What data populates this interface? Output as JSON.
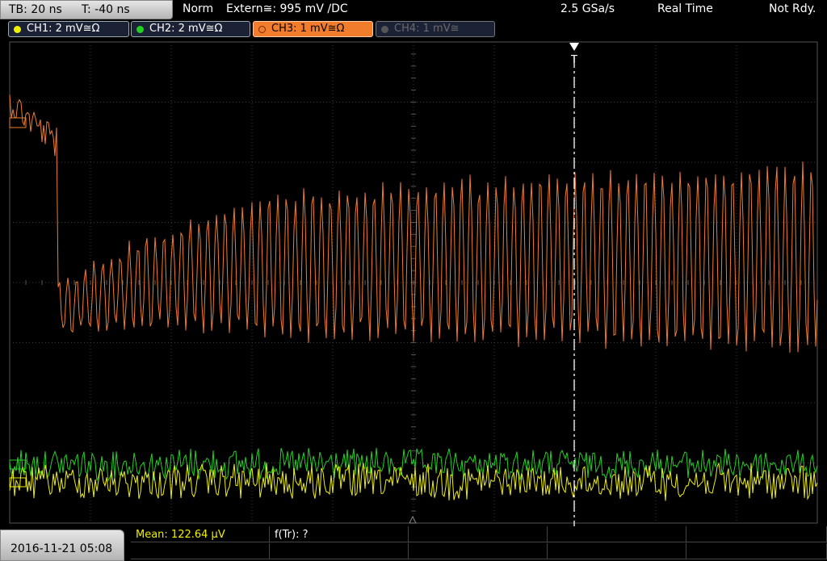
{
  "topbar": {
    "timebase": "TB: 20 ns",
    "trigger_offset": "T: -40 ns",
    "mode": "Norm",
    "trigger_source": "Extern≅: 995 mV ∕DC",
    "sample_rate": "2.5 GSa/s",
    "acq_mode": "Real Time",
    "status": "Not Rdy."
  },
  "channels": [
    {
      "label": "CH1: 2 mV≅Ω",
      "color": "#f0f000",
      "state": "on"
    },
    {
      "label": "CH2: 2 mV≅Ω",
      "color": "#22d022",
      "state": "on"
    },
    {
      "label": "CH3: 1 mV≅Ω",
      "color": "#f07c2c",
      "state": "active"
    },
    {
      "label": "CH4: 1 mV≅",
      "color": "#555555",
      "state": "off"
    }
  ],
  "measurements": {
    "mean": "Mean: 122.64 µV",
    "freq": "f(Tr): ?"
  },
  "datetime": "2016-11-21 05:08",
  "trigger_marker": "T",
  "colors": {
    "ch1": "#f0f000",
    "ch2": "#22d022",
    "ch3": "#f07c2c",
    "grid": "#3a3a3a"
  }
}
